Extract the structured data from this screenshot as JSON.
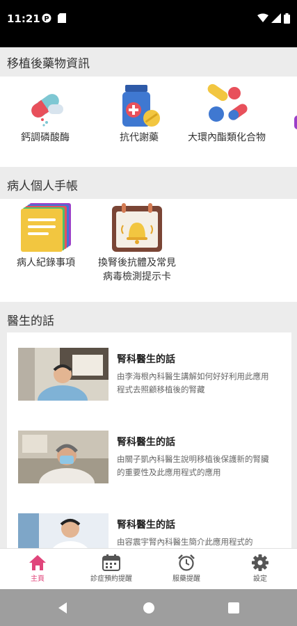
{
  "status": {
    "time": "11:21"
  },
  "sections": {
    "meds": {
      "title": "移植後藥物資訊",
      "items": [
        {
          "label": "鈣調磷酸酶",
          "icon": "capsule-pills-icon"
        },
        {
          "label": "抗代謝藥",
          "icon": "medicine-bottle-icon"
        },
        {
          "label": "大環內酯類化合物",
          "icon": "colored-pills-icon"
        }
      ]
    },
    "notes": {
      "title": "病人個人手帳",
      "items": [
        {
          "label": "病人紀錄事項",
          "icon": "sticky-notes-icon"
        },
        {
          "label": "換腎後抗體及常見病毒檢測提示卡",
          "icon": "bell-calendar-icon"
        }
      ]
    },
    "doctor": {
      "title": "醫生的話",
      "videos": [
        {
          "title": "腎科醫生的話",
          "desc": "由李海根內科醫生講解如何好好利用此應用程式去照顧移植後的腎藏"
        },
        {
          "title": "腎科醫生的話",
          "desc": "由關子凱內科醫生說明移植後保護新的腎臟的重要性及此應用程式的應用"
        },
        {
          "title": "腎科醫生的話",
          "desc": "由容震宇腎內科醫生簡介此應用程式的"
        }
      ]
    }
  },
  "nav": [
    {
      "label": "主頁",
      "icon": "home-icon",
      "active": true
    },
    {
      "label": "診症預約提醒",
      "icon": "calendar-icon",
      "active": false
    },
    {
      "label": "服藥提醒",
      "icon": "alarm-clock-icon",
      "active": false
    },
    {
      "label": "設定",
      "icon": "gear-icon",
      "active": false
    }
  ],
  "colors": {
    "accent": "#e0457b",
    "nav_inactive": "#555555"
  }
}
